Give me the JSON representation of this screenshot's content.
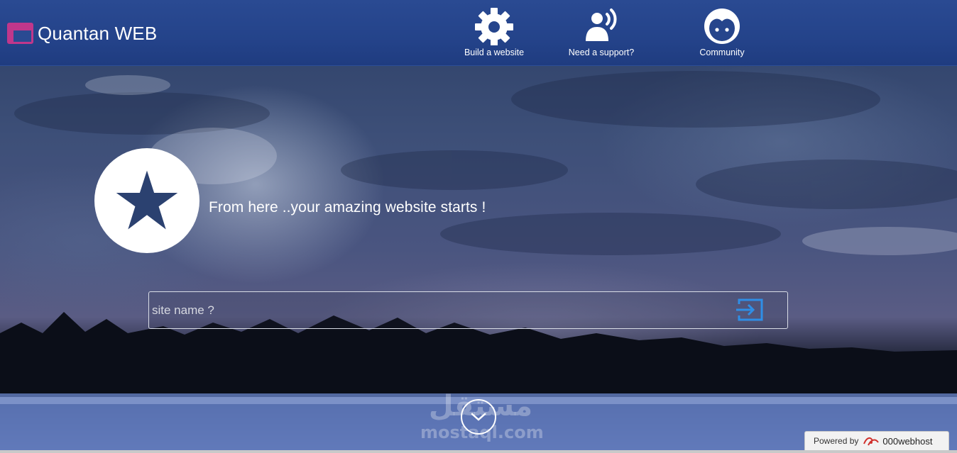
{
  "header": {
    "brand_title": "Quantan WEB",
    "nav": [
      {
        "label": "Build a website",
        "icon": "gear-icon"
      },
      {
        "label": "Need a support?",
        "icon": "support-speaker-icon"
      },
      {
        "label": "Community",
        "icon": "face-icon"
      }
    ]
  },
  "hero": {
    "icon": "star-icon",
    "tagline": "From here ..your amazing website starts !",
    "search": {
      "placeholder": "site name ?",
      "value": "",
      "submit_icon": "sign-in-icon"
    },
    "scroll_icon": "chevron-down-icon"
  },
  "watermark": {
    "arabic": "مستقل",
    "latin": "mostaql.com"
  },
  "footer_badge": {
    "label": "Powered by",
    "brand": "000webhost",
    "logo_icon": "000webhost-logo-icon"
  },
  "colors": {
    "topbar": "#24438a",
    "brand_accent": "#c0378b",
    "submit_accent": "#2f8ee6",
    "star_fill": "#2b4170"
  }
}
